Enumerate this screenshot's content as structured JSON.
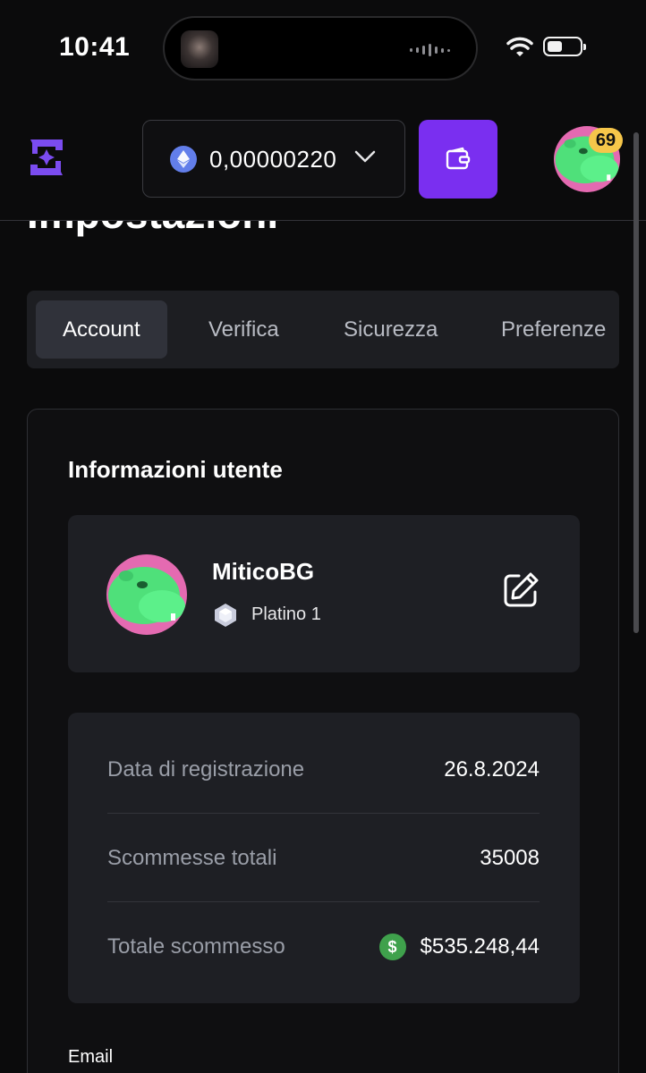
{
  "status_bar": {
    "time": "10:41"
  },
  "header": {
    "balance": "0,00000220",
    "currency_icon": "ethereum-icon",
    "wallet_icon": "wallet-icon",
    "level": "69",
    "accent_color": "#7a2ff0"
  },
  "page": {
    "title": "Impostazioni"
  },
  "tabs": [
    {
      "label": "Account",
      "active": true
    },
    {
      "label": "Verifica",
      "active": false
    },
    {
      "label": "Sicurezza",
      "active": false
    },
    {
      "label": "Preferenze",
      "active": false
    }
  ],
  "user_info": {
    "section_title": "Informazioni utente",
    "username": "MiticoBG",
    "rank": "Platino 1",
    "edit_icon": "edit-icon"
  },
  "stats": [
    {
      "label": "Data di registrazione",
      "value": "26.8.2024"
    },
    {
      "label": "Scommesse totali",
      "value": "35008"
    },
    {
      "label": "Totale scommesso",
      "value": "$535.248,44"
    }
  ],
  "email": {
    "label": "Email"
  }
}
